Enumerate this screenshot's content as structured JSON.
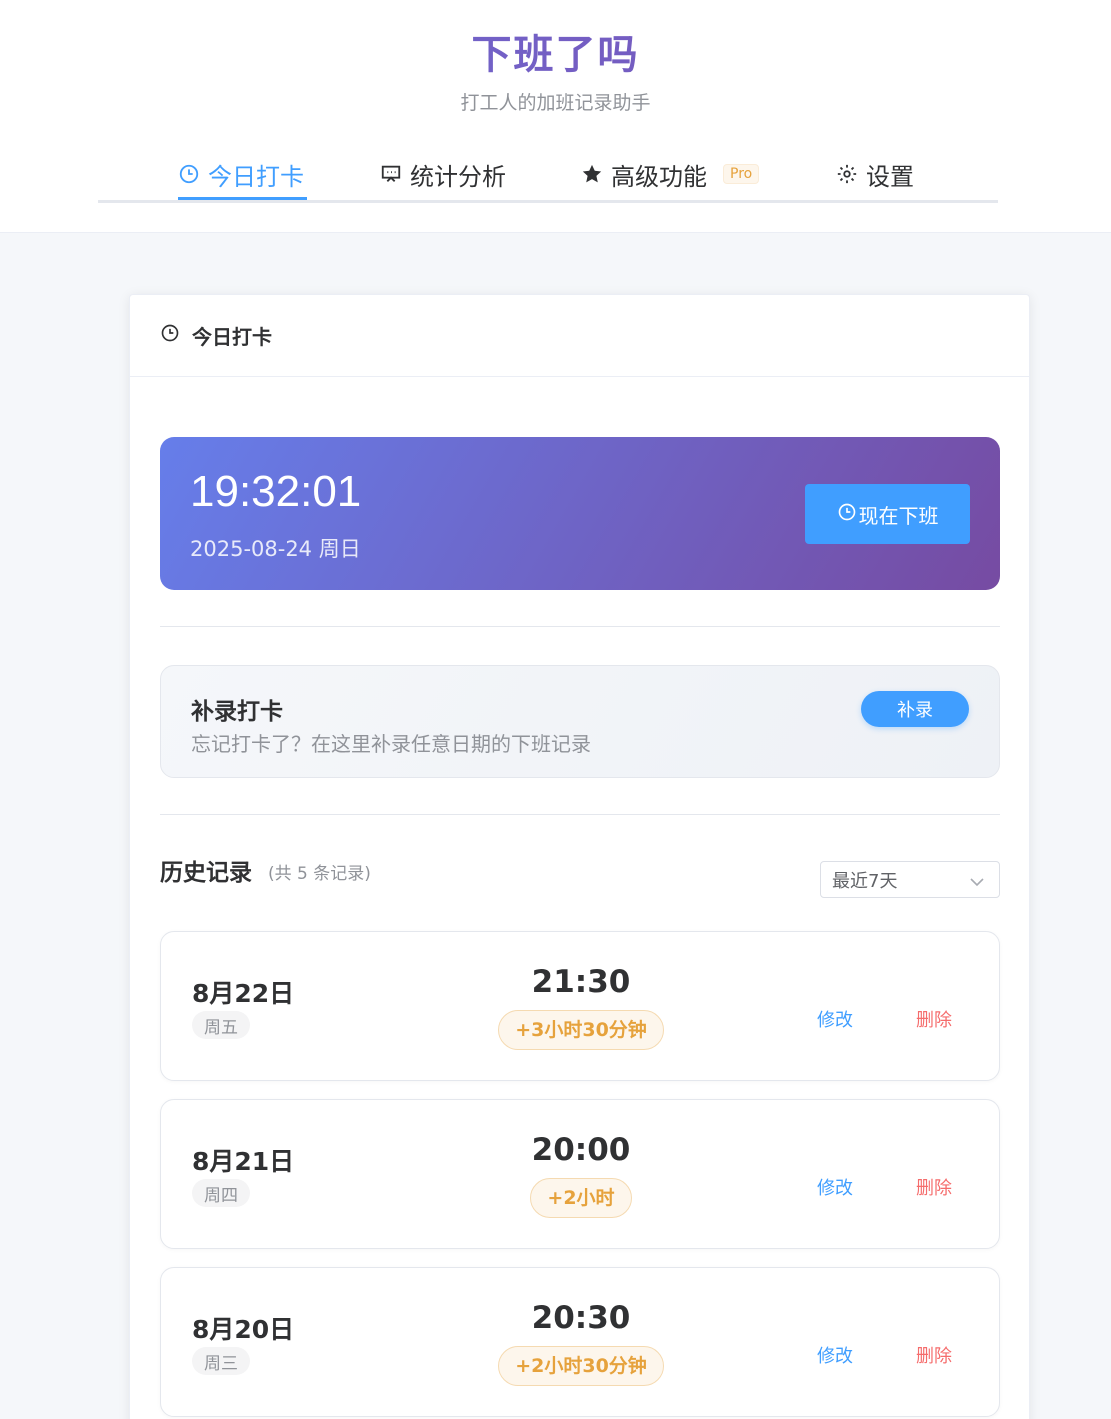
{
  "app": {
    "title": "下班了吗",
    "subtitle": "打工人的加班记录助手"
  },
  "tabs": [
    {
      "label": "今日打卡",
      "icon": "clock-icon",
      "active": true
    },
    {
      "label": "统计分析",
      "icon": "presentation-icon",
      "active": false
    },
    {
      "label": "高级功能",
      "icon": "star-icon",
      "active": false,
      "badge": "Pro"
    },
    {
      "label": "设置",
      "icon": "gear-icon",
      "active": false
    }
  ],
  "card": {
    "title": "今日打卡",
    "icon": "clock-icon"
  },
  "hero": {
    "time": "19:32:01",
    "date": "2025-08-24 周日",
    "button_label": "现在下班",
    "gradient": [
      "#667eea",
      "#764ba2"
    ]
  },
  "supplement": {
    "title": "补录打卡",
    "description": "忘记打卡了？在这里补录任意日期的下班记录",
    "button_label": "补录"
  },
  "history": {
    "title": "历史记录",
    "count_text": "(共 5 条记录)",
    "range_selected": "最近7天",
    "records": [
      {
        "date": "8月22日",
        "weekday": "周五",
        "time": "21:30",
        "overtime": "+3小时30分钟",
        "edit_label": "修改",
        "delete_label": "删除"
      },
      {
        "date": "8月21日",
        "weekday": "周四",
        "time": "20:00",
        "overtime": "+2小时",
        "edit_label": "修改",
        "delete_label": "删除"
      },
      {
        "date": "8月20日",
        "weekday": "周三",
        "time": "20:30",
        "overtime": "+2小时30分钟",
        "edit_label": "修改",
        "delete_label": "删除"
      }
    ]
  },
  "colors": {
    "primary": "#409eff",
    "warning": "#e6a23c",
    "danger": "#f56c6c",
    "brand": "#6a5acd"
  }
}
